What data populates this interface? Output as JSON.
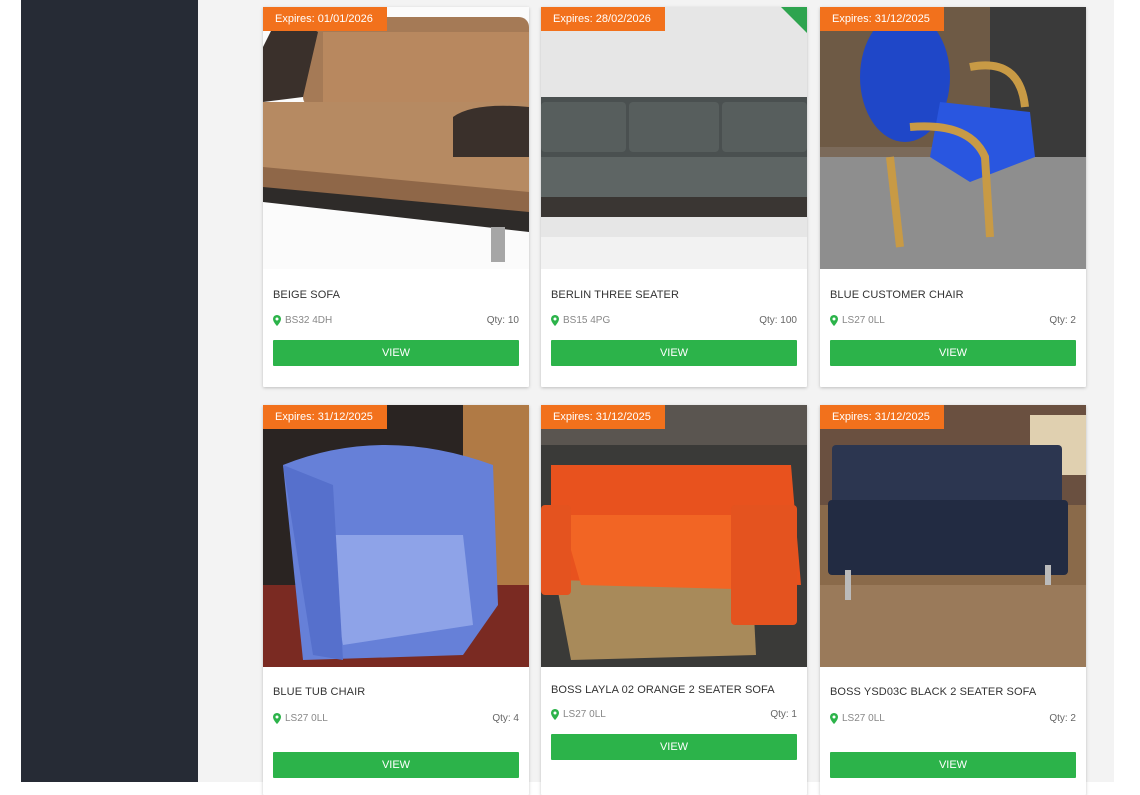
{
  "products": [
    {
      "expiry": "Expires: 01/01/2026",
      "title": "BEIGE SOFA",
      "location": "BS32 4DH",
      "qty": "Qty: 10",
      "view_label": "VIEW"
    },
    {
      "expiry": "Expires: 28/02/2026",
      "title": "BERLIN THREE SEATER",
      "location": "BS15 4PG",
      "qty": "Qty: 100",
      "view_label": "VIEW"
    },
    {
      "expiry": "Expires: 31/12/2025",
      "title": "BLUE CUSTOMER CHAIR",
      "location": "LS27 0LL",
      "qty": "Qty: 2",
      "view_label": "VIEW"
    },
    {
      "expiry": "Expires: 31/12/2025",
      "title": "BLUE TUB CHAIR",
      "location": "LS27 0LL",
      "qty": "Qty: 4",
      "view_label": "VIEW"
    },
    {
      "expiry": "Expires: 31/12/2025",
      "title": "BOSS LAYLA 02 ORANGE 2 SEATER SOFA",
      "location": "LS27 0LL",
      "qty": "Qty: 1",
      "view_label": "VIEW"
    },
    {
      "expiry": "Expires: 31/12/2025",
      "title": "BOSS YSD03C BLACK 2 SEATER SOFA",
      "location": "LS27 0LL",
      "qty": "Qty: 2",
      "view_label": "VIEW"
    }
  ],
  "colors": {
    "sidebar": "#262b35",
    "expiry_badge": "#f2711c",
    "view_button": "#2cb34a",
    "pin": "#2cb34a",
    "featured_flag": "#2ea44f"
  },
  "icons": {
    "location": "map-pin-icon",
    "featured": "featured-corner-flag"
  }
}
